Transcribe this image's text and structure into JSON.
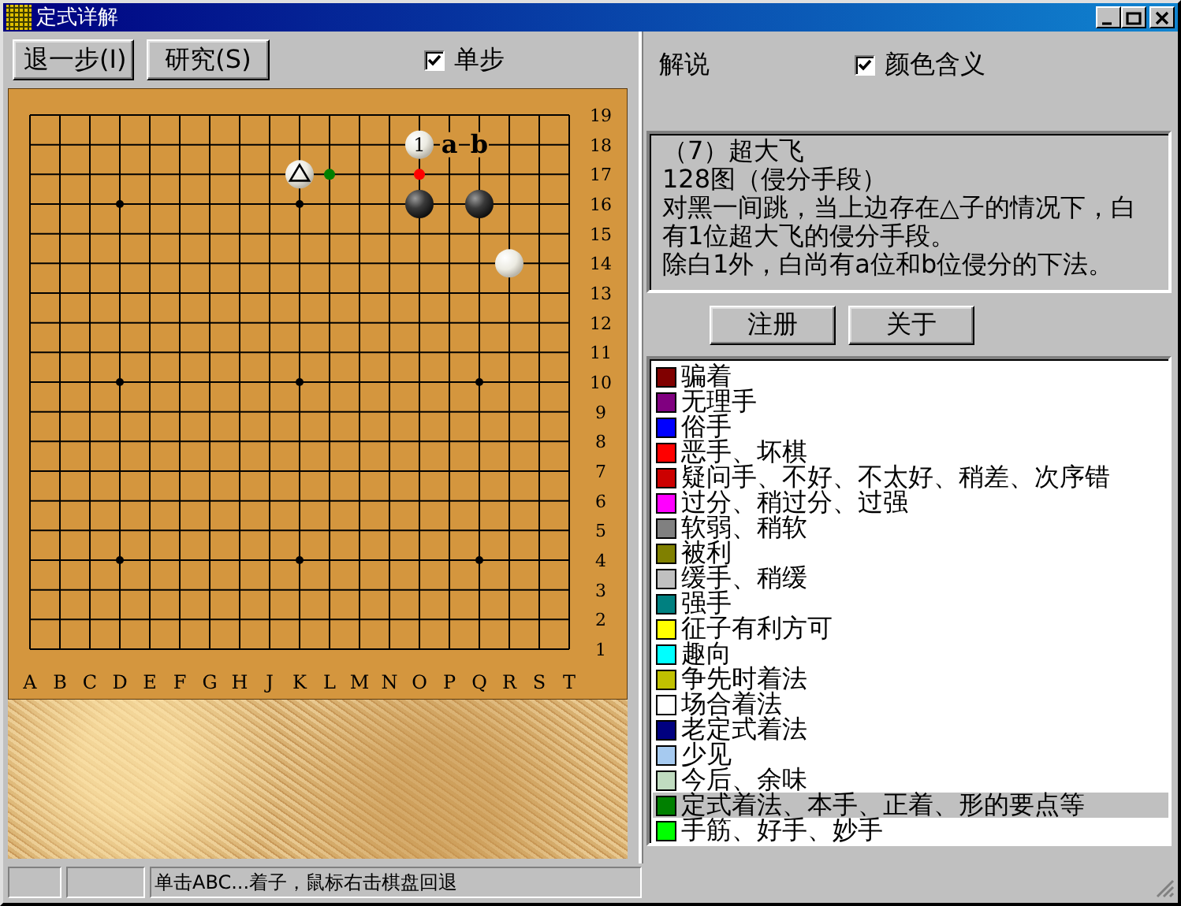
{
  "window": {
    "title": "定式详解"
  },
  "toolbar": {
    "buttons": [
      "退一步(I)",
      "研究(S)"
    ],
    "single_step": {
      "label": "单步",
      "checked": true
    }
  },
  "board": {
    "columns": [
      "A",
      "B",
      "C",
      "D",
      "E",
      "F",
      "G",
      "H",
      "J",
      "K",
      "L",
      "M",
      "N",
      "O",
      "P",
      "Q",
      "R",
      "S",
      "T"
    ],
    "rows": [
      "19",
      "18",
      "17",
      "16",
      "15",
      "14",
      "13",
      "12",
      "11",
      "10",
      "9",
      "8",
      "7",
      "6",
      "5",
      "4",
      "3",
      "2",
      "1"
    ],
    "stones": [
      {
        "kind": "triangle"
      },
      {
        "kind": "white",
        "label": "1"
      },
      {
        "kind": "black"
      },
      {
        "kind": "black"
      },
      {
        "kind": "white"
      }
    ],
    "letters": [
      "a",
      "b"
    ],
    "dots": [
      {
        "color": "#008000"
      },
      {
        "color": "#ff0000"
      }
    ]
  },
  "commentary": {
    "heading": "解说",
    "color_meaning": {
      "label": "颜色含义",
      "checked": true
    },
    "paragraphs": [
      "（7）超大飞",
      "128图（侵分手段）",
      "对黑一间跳，当上边存在△子的情况下，白有1位超大飞的侵分手段。",
      "除白1外，白尚有a位和b位侵分的下法。"
    ]
  },
  "buttons": [
    "注册",
    "关于"
  ],
  "legend": [
    {
      "label": "骗着",
      "color": "#800000",
      "selected": false
    },
    {
      "label": "无理手",
      "color": "#800080",
      "selected": false
    },
    {
      "label": "俗手",
      "color": "#0000ff",
      "selected": false
    },
    {
      "label": "恶手、坏棋",
      "color": "#ff0000",
      "selected": false
    },
    {
      "label": "疑问手、不好、不太好、稍差、次序错",
      "color": "#cc0000",
      "selected": false
    },
    {
      "label": "过分、稍过分、过强",
      "color": "#ff00ff",
      "selected": false
    },
    {
      "label": "软弱、稍软",
      "color": "#808080",
      "selected": false
    },
    {
      "label": "被利",
      "color": "#808000",
      "selected": false
    },
    {
      "label": "缓手、稍缓",
      "color": "#c0c0c0",
      "selected": false
    },
    {
      "label": "强手",
      "color": "#008080",
      "selected": false
    },
    {
      "label": "征子有利方可",
      "color": "#ffff00",
      "selected": false
    },
    {
      "label": "趣向",
      "color": "#00ffff",
      "selected": false
    },
    {
      "label": "争先时着法",
      "color": "#c0c000",
      "selected": false
    },
    {
      "label": "场合着法",
      "color": "#ffffff",
      "selected": false
    },
    {
      "label": "老定式着法",
      "color": "#000080",
      "selected": false
    },
    {
      "label": "少见",
      "color": "#a6caf0",
      "selected": false
    },
    {
      "label": "今后、余味",
      "color": "#c0dcc0",
      "selected": false
    },
    {
      "label": "定式着法、本手、正着、形的要点等",
      "color": "#008000",
      "selected": true
    },
    {
      "label": "手筋、好手、妙手",
      "color": "#00ff00",
      "selected": false
    }
  ],
  "status_bar": {
    "message": "单击ABC...着子，鼠标右击棋盘回退"
  }
}
